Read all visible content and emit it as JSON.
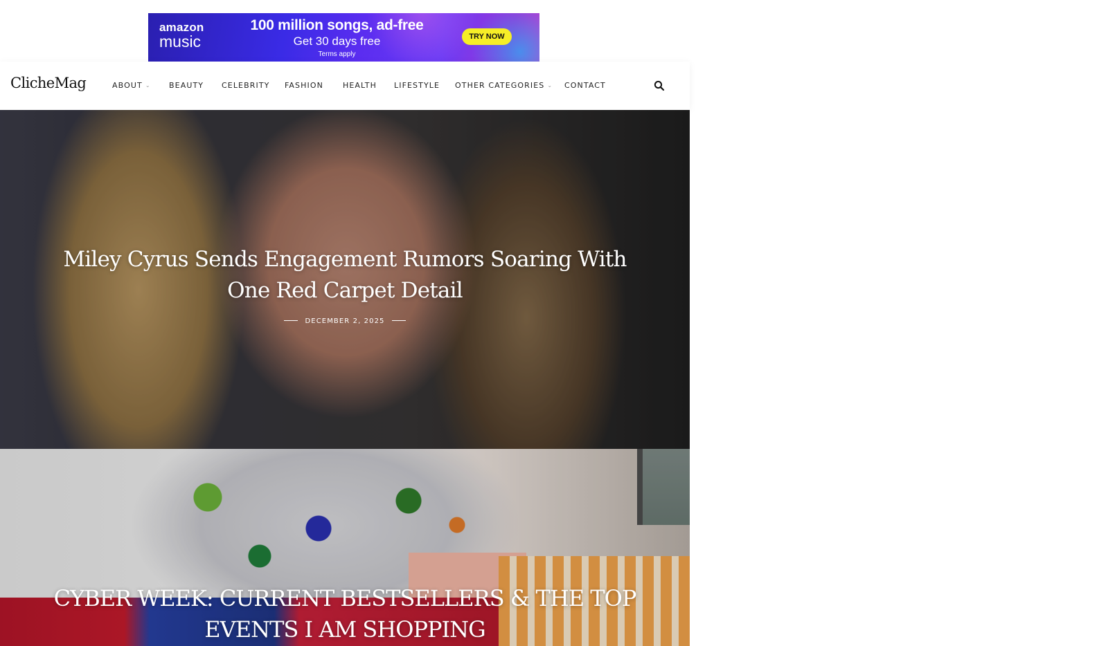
{
  "ad": {
    "brand_line1": "amazon",
    "brand_line2": "music",
    "headline": "100 million songs, ad-free",
    "subline": "Get 30 days free",
    "terms": "Terms apply",
    "cta": "TRY NOW",
    "colors": {
      "background": "#3a2be6",
      "cta": "#f6ee27"
    }
  },
  "header": {
    "logo": "ClicheMag",
    "nav": [
      {
        "label": "ABOUT",
        "has_dropdown": true
      },
      {
        "label": "BEAUTY",
        "has_dropdown": false
      },
      {
        "label": "CELEBRITY",
        "has_dropdown": false
      },
      {
        "label": "FASHION",
        "has_dropdown": false
      },
      {
        "label": "HEALTH",
        "has_dropdown": false
      },
      {
        "label": "LIFESTYLE",
        "has_dropdown": false
      },
      {
        "label": "OTHER CATEGORIES",
        "has_dropdown": true
      },
      {
        "label": "CONTACT",
        "has_dropdown": false
      }
    ],
    "search_icon": "search-icon",
    "dropdown_icon": "chevron-down-icon"
  },
  "posts": [
    {
      "title": "Miley Cyrus Sends Engagement Rumors Soaring With One Red Carpet Detail",
      "date": "DECEMBER 2, 2025"
    },
    {
      "title": "CYBER WEEK: CURRENT BESTSELLERS & THE TOP EVENTS I AM SHOPPING"
    }
  ]
}
